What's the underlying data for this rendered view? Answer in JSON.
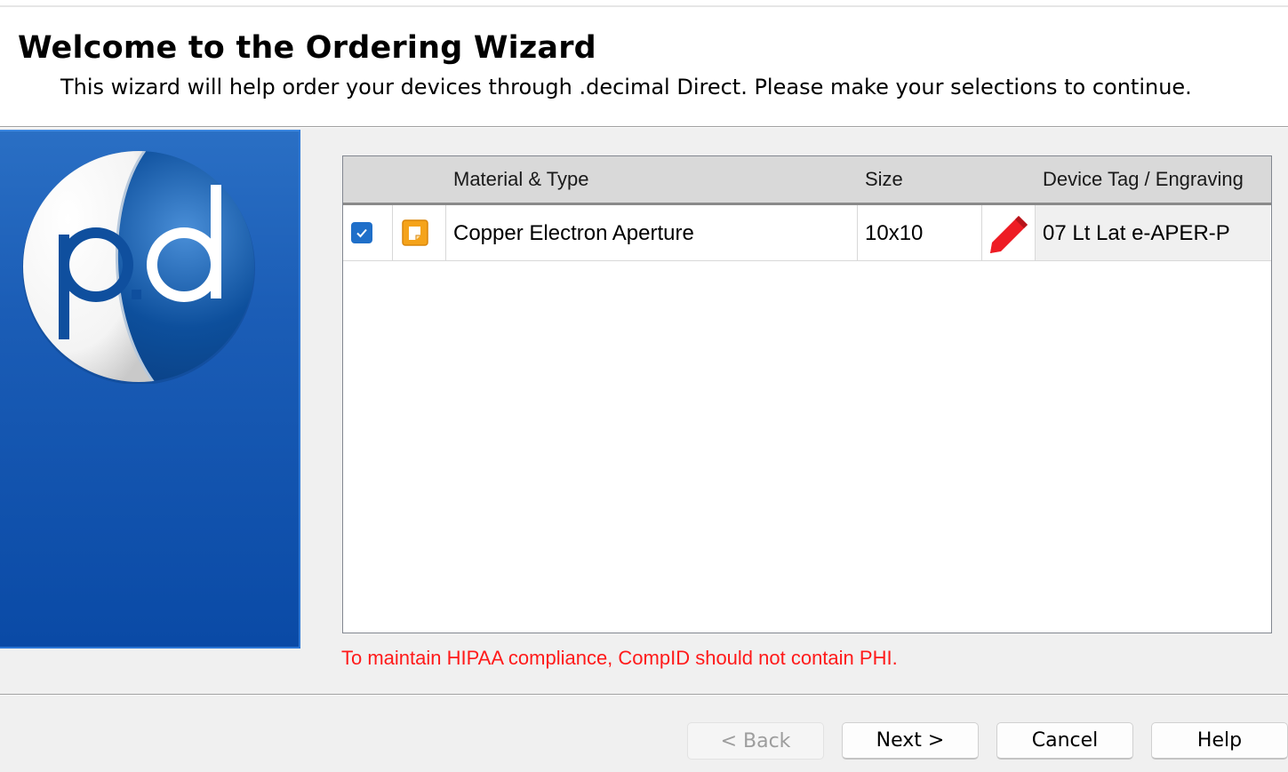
{
  "header": {
    "title": "Welcome to the Ordering Wizard",
    "subtitle": "This wizard will help order your devices through .decimal Direct. Please make your selections to continue."
  },
  "logo": {
    "alt": "p.d logo"
  },
  "grid": {
    "columns": [
      "Material & Type",
      "Size",
      "Device Tag / Engraving"
    ],
    "rows": [
      {
        "checked": true,
        "material_type": "Copper Electron Aperture",
        "size": "10x10",
        "device_tag": "07 Lt Lat e-APER-P"
      }
    ]
  },
  "notice": "To maintain HIPAA compliance, CompID should not contain PHI.",
  "buttons": {
    "back": "< Back",
    "next": "Next >",
    "cancel": "Cancel",
    "help": "Help"
  },
  "colors": {
    "panel_blue": "#1b5db6",
    "checkbox_blue": "#1f6fc9",
    "warning_red": "#ff1a1a",
    "pencil_red": "#ee1c24",
    "doc_icon_orange": "#f5a31a"
  },
  "icons": [
    "pd-logo-icon",
    "checkbox-checked-icon",
    "document-icon",
    "pencil-icon"
  ]
}
